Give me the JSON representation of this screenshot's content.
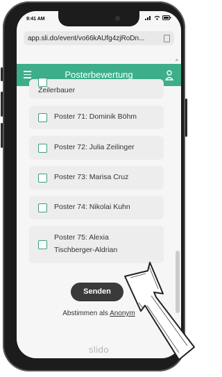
{
  "status": {
    "time": "9:41 AM"
  },
  "browser": {
    "url": "app.sli.do/event/vo66kAUfg4zjRoDn..."
  },
  "header": {
    "title": "Posterbewertung"
  },
  "posters": [
    {
      "line1": "Zeilerbauer",
      "line2": ""
    },
    {
      "line1": "Poster 71: Dominik Böhm",
      "line2": ""
    },
    {
      "line1": "Poster 72: Julia Zeilinger",
      "line2": ""
    },
    {
      "line1": "Poster 73: Marisa Cruz",
      "line2": ""
    },
    {
      "line1": "Poster 74: Nikolai Kuhn",
      "line2": ""
    },
    {
      "line1": "Poster 75: Alexia",
      "line2": "Tischberger-Aldrian"
    }
  ],
  "actions": {
    "send_label": "Senden",
    "anon_prefix": "Abstimmen als ",
    "anon_link": "Anonym"
  },
  "footer": {
    "brand": "slido"
  },
  "colors": {
    "accent": "#3dae8a",
    "send_bg": "#3a3a3a"
  },
  "icons": [
    "menu-icon",
    "user-icon",
    "copy-icon",
    "signal-icon",
    "wifi-icon",
    "battery-icon",
    "hand-drawn-arrow"
  ]
}
